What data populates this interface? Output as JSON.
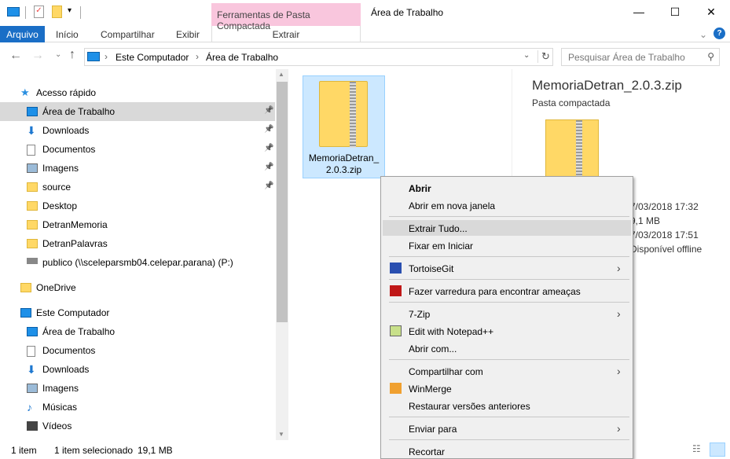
{
  "window": {
    "title": "Área de Trabalho",
    "context_tab": "Ferramentas de Pasta Compactada",
    "context_subtab": "Extrair",
    "minimize": "—",
    "maximize": "☐",
    "close": "✕"
  },
  "ribbon": {
    "tabs": [
      "Arquivo",
      "Início",
      "Compartilhar",
      "Exibir"
    ],
    "help": "?"
  },
  "nav": {
    "breadcrumb": [
      "Este Computador",
      "Área de Trabalho"
    ],
    "search_placeholder": "Pesquisar Área de Trabalho"
  },
  "sidebar": {
    "items": [
      {
        "label": "Acesso rápido",
        "icon": "star-icon",
        "pinned": false
      },
      {
        "label": "Área de Trabalho",
        "icon": "desktop-icon",
        "pinned": true,
        "selected": true
      },
      {
        "label": "Downloads",
        "icon": "download-icon",
        "pinned": true
      },
      {
        "label": "Documentos",
        "icon": "document-icon",
        "pinned": true
      },
      {
        "label": "Imagens",
        "icon": "image-icon",
        "pinned": true
      },
      {
        "label": "source",
        "icon": "folder-icon",
        "pinned": true
      },
      {
        "label": "Desktop",
        "icon": "folder-icon"
      },
      {
        "label": "DetranMemoria",
        "icon": "folder-icon"
      },
      {
        "label": "DetranPalavras",
        "icon": "folder-icon"
      },
      {
        "label": "publico (\\\\sceleparsmb04.celepar.parana) (P:)",
        "icon": "network-drive-icon"
      },
      {
        "label": "OneDrive",
        "icon": "folder-icon"
      },
      {
        "label": "Este Computador",
        "icon": "computer-icon"
      },
      {
        "label": "Área de Trabalho",
        "icon": "desktop-icon"
      },
      {
        "label": "Documentos",
        "icon": "document-icon"
      },
      {
        "label": "Downloads",
        "icon": "download-icon"
      },
      {
        "label": "Imagens",
        "icon": "image-icon"
      },
      {
        "label": "Músicas",
        "icon": "music-icon"
      },
      {
        "label": "Vídeos",
        "icon": "video-icon"
      }
    ]
  },
  "file": {
    "name_line1": "MemoriaDetran_",
    "name_line2": "2.0.3.zip"
  },
  "details": {
    "name": "MemoriaDetran_2.0.3.zip",
    "type": "Pasta compactada",
    "modified": "7/03/2018 17:32",
    "size": "9,1 MB",
    "created": "7/03/2018 17:51",
    "availability": "Disponível offline"
  },
  "context_menu": {
    "items": [
      {
        "label": "Abrir",
        "bold": true
      },
      {
        "label": "Abrir em nova janela"
      },
      {
        "label": "Extrair Tudo...",
        "highlighted": true
      },
      {
        "label": "Fixar em Iniciar"
      },
      {
        "label": "TortoiseGit",
        "submenu": true,
        "icon": "tortoisegit-icon"
      },
      {
        "label": "Fazer varredura para encontrar ameaças",
        "icon": "mcafee-icon"
      },
      {
        "label": "7-Zip",
        "submenu": true
      },
      {
        "label": "Edit with Notepad++",
        "icon": "notepad-icon"
      },
      {
        "label": "Abrir com..."
      },
      {
        "label": "Compartilhar com",
        "submenu": true
      },
      {
        "label": "WinMerge",
        "icon": "winmerge-icon"
      },
      {
        "label": "Restaurar versões anteriores"
      },
      {
        "label": "Enviar para",
        "submenu": true
      },
      {
        "label": "Recortar"
      }
    ]
  },
  "status": {
    "count": "1 item",
    "selection": "1 item selecionado",
    "size": "19,1 MB"
  },
  "colors": {
    "accent": "#1a6ec6",
    "context_tab": "#f9c6dd",
    "selection": "#cce8ff"
  }
}
